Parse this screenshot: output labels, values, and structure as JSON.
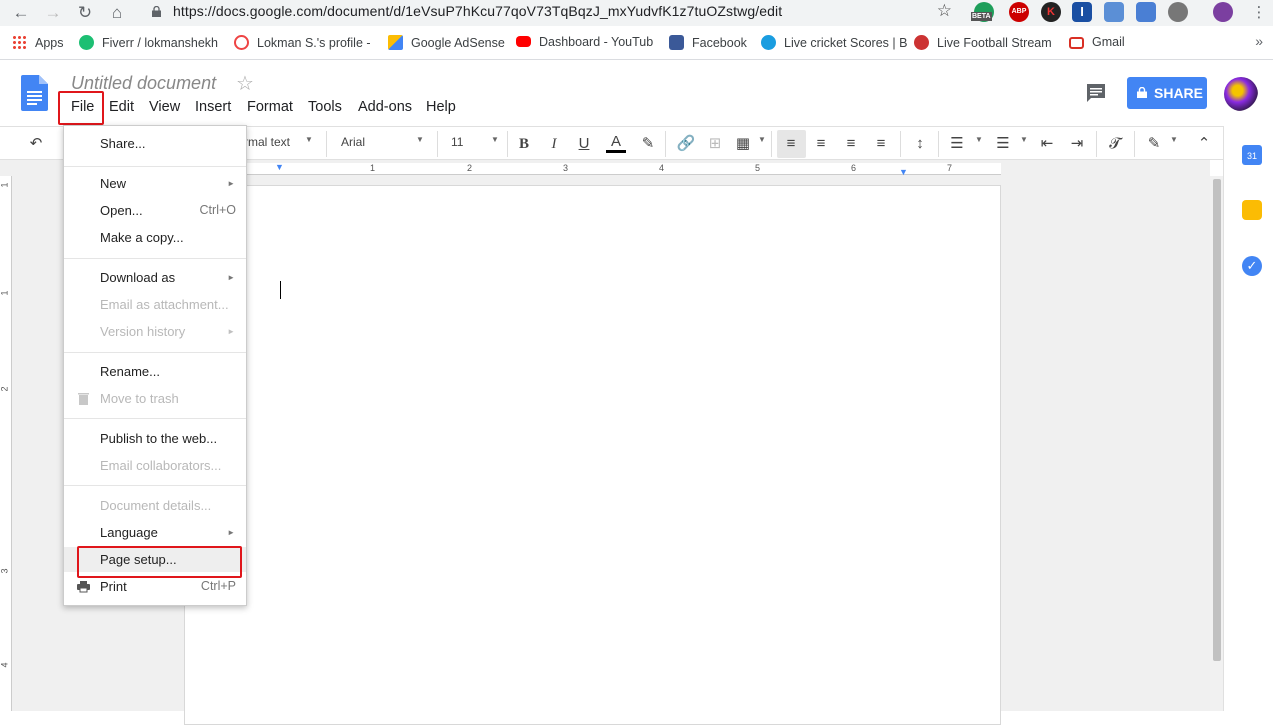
{
  "browser": {
    "url": "https://docs.google.com/document/d/1eVsuP7hKcu77qoV73TqBqzJ_mxYudvfK1z7tuOZstwg/edit",
    "ext_beta_label": "BETA",
    "ext_abp_label": "ABP",
    "ext_k_label": "K",
    "ext_i_label": "I"
  },
  "bookmarks": [
    {
      "label": "Apps"
    },
    {
      "label": "Fiverr / lokmanshekh"
    },
    {
      "label": "Lokman S.'s profile -"
    },
    {
      "label": "Google AdSense"
    },
    {
      "label": "Dashboard - YouTub"
    },
    {
      "label": "Facebook"
    },
    {
      "label": "Live cricket Scores | B"
    },
    {
      "label": "Live Football Stream"
    },
    {
      "label": "Gmail"
    }
  ],
  "doc": {
    "title": "Untitled document",
    "share_label": "SHARE"
  },
  "menubar": [
    "File",
    "Edit",
    "View",
    "Insert",
    "Format",
    "Tools",
    "Add-ons",
    "Help"
  ],
  "toolbar": {
    "style": "rmal text",
    "font": "Arial",
    "size": "11"
  },
  "ruler": [
    "1",
    "1",
    "2",
    "3",
    "4",
    "5",
    "6",
    "7"
  ],
  "vruler": [
    "1",
    "1",
    "2",
    "3",
    "4"
  ],
  "side_panel": {
    "calendar_label": "31"
  },
  "file_menu": {
    "share": "Share...",
    "new": "New",
    "open": "Open...",
    "open_shortcut": "Ctrl+O",
    "make_copy": "Make a copy...",
    "download_as": "Download as",
    "email_attachment": "Email as attachment...",
    "version_history": "Version history",
    "rename": "Rename...",
    "move_to_trash": "Move to trash",
    "publish": "Publish to the web...",
    "email_collaborators": "Email collaborators...",
    "document_details": "Document details...",
    "language": "Language",
    "page_setup": "Page setup...",
    "print": "Print",
    "print_shortcut": "Ctrl+P"
  },
  "colors": {
    "brand_blue": "#4285f4",
    "highlight_red": "#e0161b"
  }
}
